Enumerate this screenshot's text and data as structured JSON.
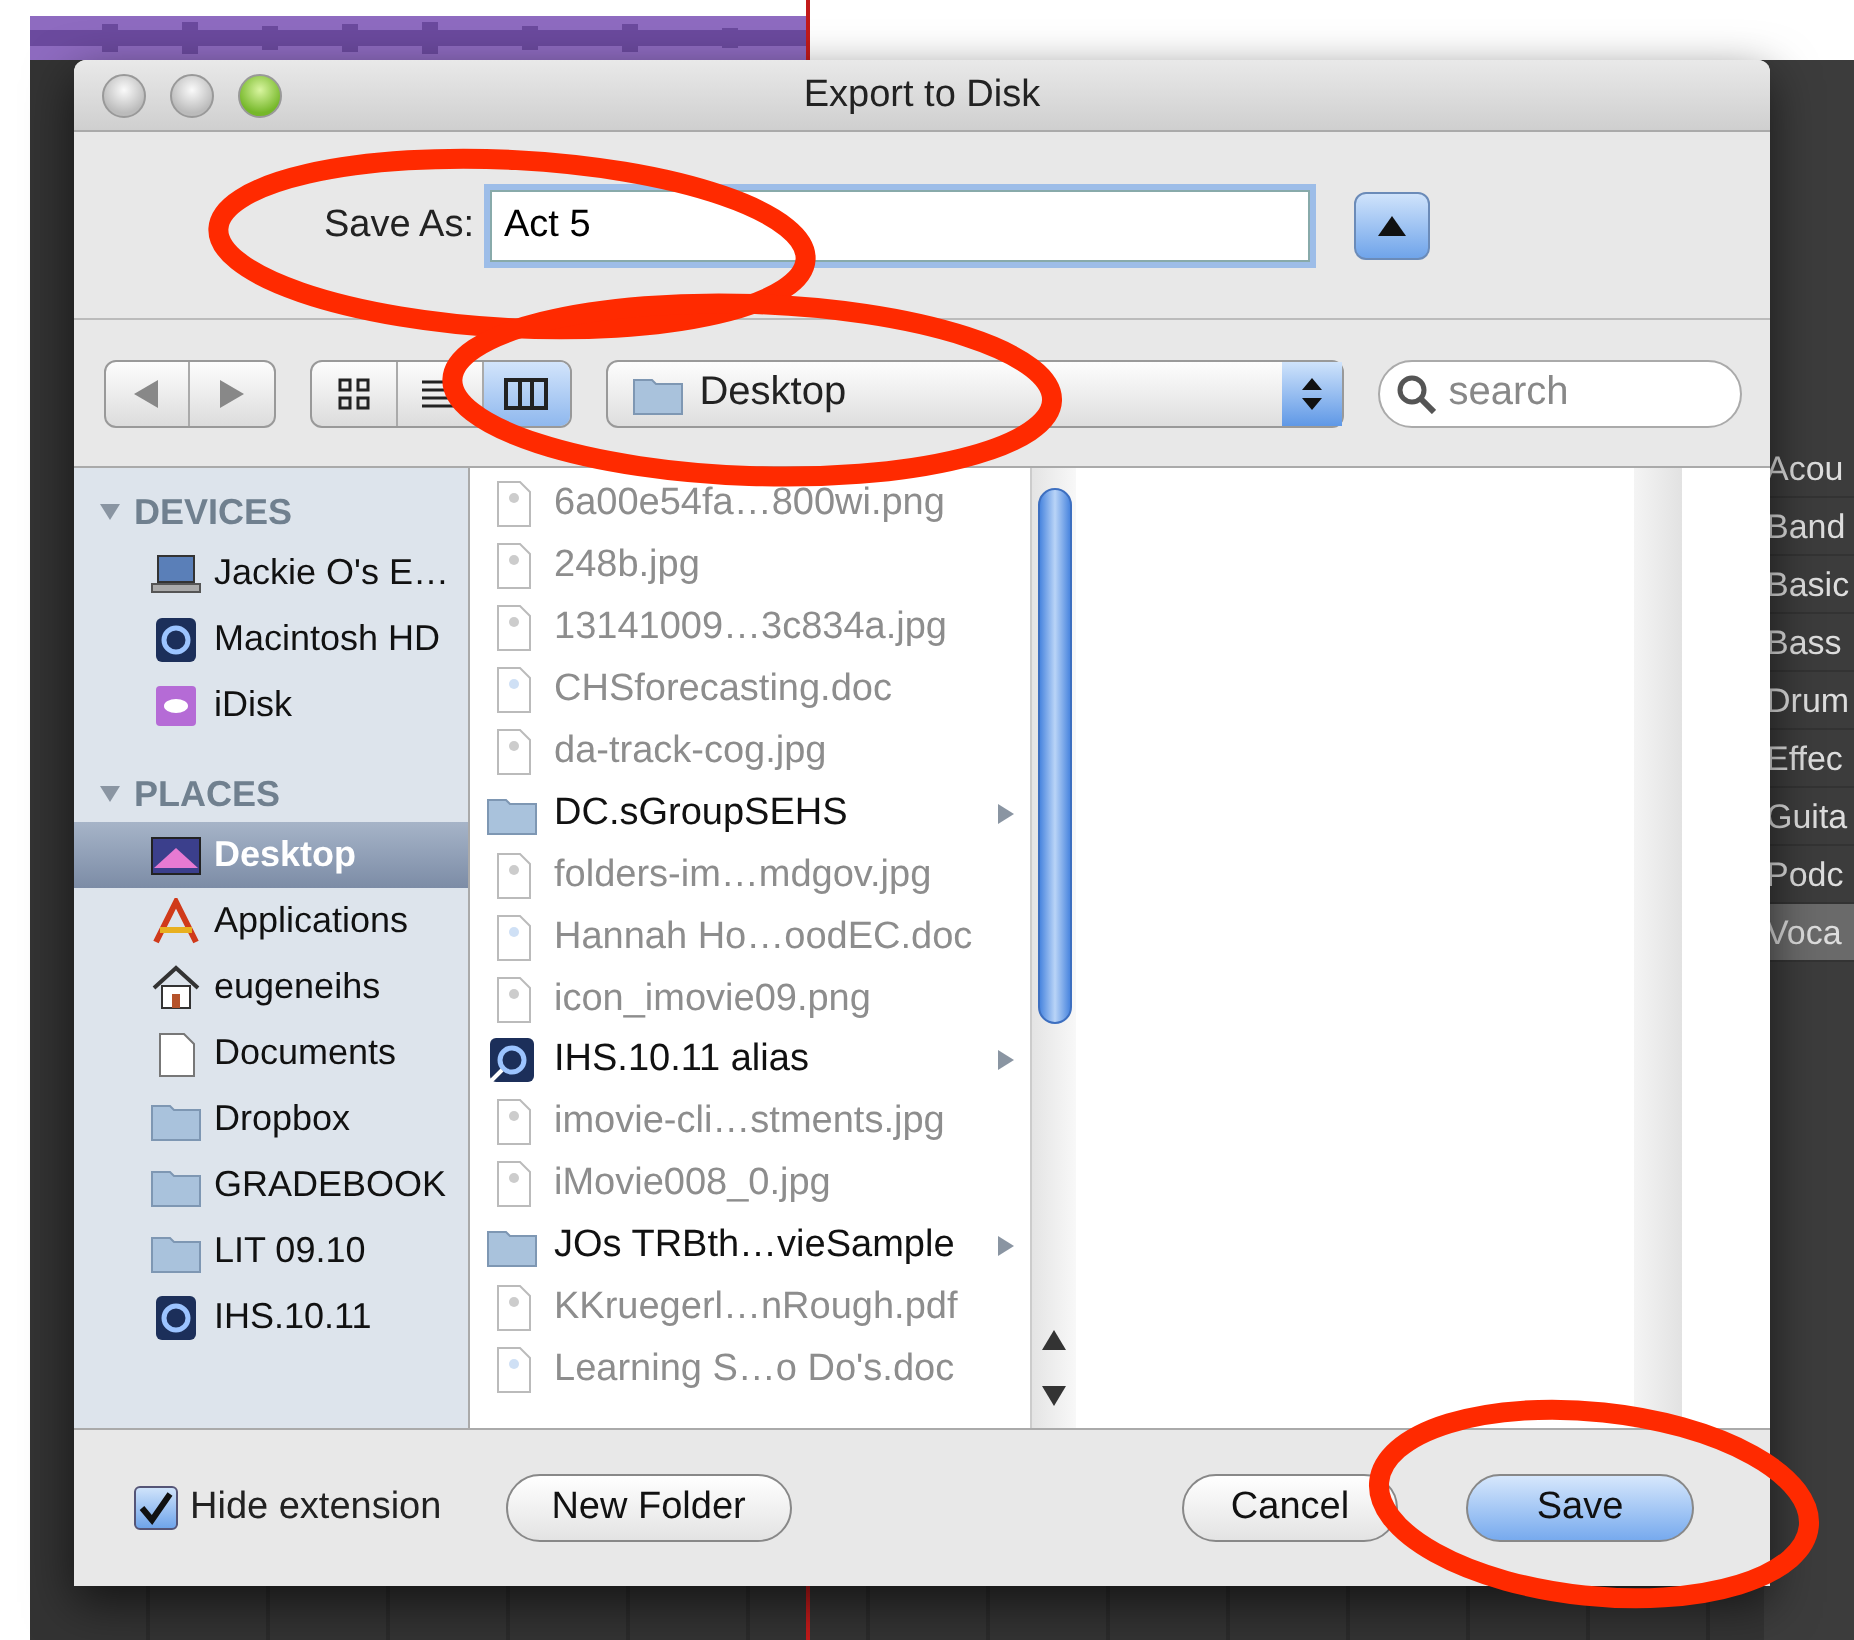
{
  "window": {
    "title": "Export to Disk"
  },
  "save_as": {
    "label": "Save As:",
    "value": "Act 5"
  },
  "toolbar": {
    "view_modes": [
      {
        "kind": "icon",
        "selected": false
      },
      {
        "kind": "list",
        "selected": false
      },
      {
        "kind": "column",
        "selected": true
      }
    ],
    "location": "Desktop",
    "search": {
      "placeholder": "search"
    }
  },
  "sidebar": {
    "sections": [
      {
        "title": "DEVICES",
        "expanded": true,
        "items": [
          {
            "label": "Jackie O's E…",
            "kind": "laptop",
            "selected": false
          },
          {
            "label": "Macintosh HD",
            "kind": "drive",
            "selected": false
          },
          {
            "label": "iDisk",
            "kind": "cloud",
            "selected": false
          }
        ]
      },
      {
        "title": "PLACES",
        "expanded": true,
        "items": [
          {
            "label": "Desktop",
            "kind": "desktop",
            "selected": true
          },
          {
            "label": "Applications",
            "kind": "apps",
            "selected": false
          },
          {
            "label": "eugeneihs",
            "kind": "home",
            "selected": false
          },
          {
            "label": "Documents",
            "kind": "documents",
            "selected": false
          },
          {
            "label": "Dropbox",
            "kind": "folder",
            "selected": false
          },
          {
            "label": "GRADEBOOK",
            "kind": "folder",
            "selected": false
          },
          {
            "label": "LIT 09.10",
            "kind": "folder",
            "selected": false
          },
          {
            "label": "IHS.10.11",
            "kind": "drive",
            "selected": false
          }
        ]
      }
    ]
  },
  "files": [
    {
      "name": "6a00e54fa…800wi.png",
      "kind": "image",
      "dimmed": true
    },
    {
      "name": "248b.jpg",
      "kind": "image",
      "dimmed": true
    },
    {
      "name": "13141009…3c834a.jpg",
      "kind": "image",
      "dimmed": true
    },
    {
      "name": "CHSforecasting.doc",
      "kind": "doc",
      "dimmed": true
    },
    {
      "name": "da-track-cog.jpg",
      "kind": "image",
      "dimmed": true
    },
    {
      "name": "DC.sGroupSEHS",
      "kind": "folder",
      "dimmed": false
    },
    {
      "name": "folders-im…mdgov.jpg",
      "kind": "image",
      "dimmed": true
    },
    {
      "name": "Hannah Ho…oodEC.doc",
      "kind": "doc",
      "dimmed": true
    },
    {
      "name": "icon_imovie09.png",
      "kind": "image",
      "dimmed": true
    },
    {
      "name": "IHS.10.11 alias",
      "kind": "alias",
      "dimmed": false
    },
    {
      "name": "imovie-cli…stments.jpg",
      "kind": "image",
      "dimmed": true
    },
    {
      "name": "iMovie008_0.jpg",
      "kind": "image",
      "dimmed": true
    },
    {
      "name": "JOs TRBth…vieSample",
      "kind": "folder",
      "dimmed": false
    },
    {
      "name": "KKruegerl…nRough.pdf",
      "kind": "image",
      "dimmed": true
    },
    {
      "name": "Learning S…o Do's.doc",
      "kind": "doc",
      "dimmed": true
    }
  ],
  "hide_extension": {
    "label": "Hide extension",
    "checked": true
  },
  "buttons": [
    {
      "label": "New Folder",
      "kind": "plain"
    },
    {
      "label": "Cancel",
      "kind": "plain"
    },
    {
      "label": "Save",
      "kind": "default"
    }
  ],
  "track_list": [
    {
      "label": "Acou",
      "selected": false
    },
    {
      "label": "Band",
      "selected": false
    },
    {
      "label": "Basic",
      "selected": false
    },
    {
      "label": "Bass",
      "selected": false
    },
    {
      "label": "Drum",
      "selected": false
    },
    {
      "label": "Effec",
      "selected": false
    },
    {
      "label": "Guita",
      "selected": false
    },
    {
      "label": "Podc",
      "selected": false
    },
    {
      "label": "Voca",
      "selected": true
    }
  ]
}
